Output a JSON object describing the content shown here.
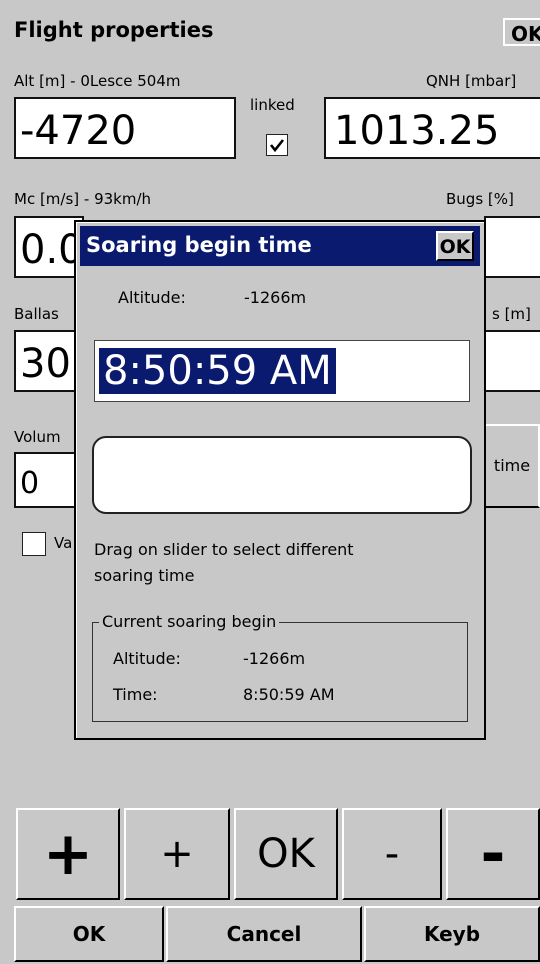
{
  "titlebar": {
    "title": "Flight properties",
    "ok_label": "OK"
  },
  "altitude": {
    "label": "Alt [m] - 0Lesce 504m",
    "value": "-4720"
  },
  "linked": {
    "label": "linked",
    "checked": true
  },
  "qnh": {
    "label": "QNH [mbar]",
    "value": "1013.25"
  },
  "mc": {
    "label": "Mc [m/s] - 93km/h",
    "value": "0.0"
  },
  "bugs": {
    "label": "Bugs [%]"
  },
  "ballast": {
    "label": "Ballas",
    "value": "30"
  },
  "right_label2": {
    "label": "s [m]"
  },
  "volume": {
    "label": "Volum",
    "value": "0"
  },
  "time_button": {
    "label": "time"
  },
  "var_checkbox": {
    "label": "Va"
  },
  "dialog": {
    "title": "Soaring begin time",
    "ok_label": "OK",
    "altitude_label": "Altitude:",
    "altitude_value": "-1266m",
    "time_value": "8:50:59 AM",
    "hint_line1": "Drag on slider to select different",
    "hint_line2": "soaring time",
    "current": {
      "legend": "Current soaring begin",
      "altitude_label": "Altitude:",
      "altitude_value": "-1266m",
      "time_label": "Time:",
      "time_value": "8:50:59 AM"
    }
  },
  "steppers": {
    "big_plus": "+",
    "plus": "+",
    "ok": "OK",
    "minus": "-",
    "big_minus": "-"
  },
  "bottom": {
    "ok": "OK",
    "cancel": "Cancel",
    "keyb": "Keyb"
  }
}
